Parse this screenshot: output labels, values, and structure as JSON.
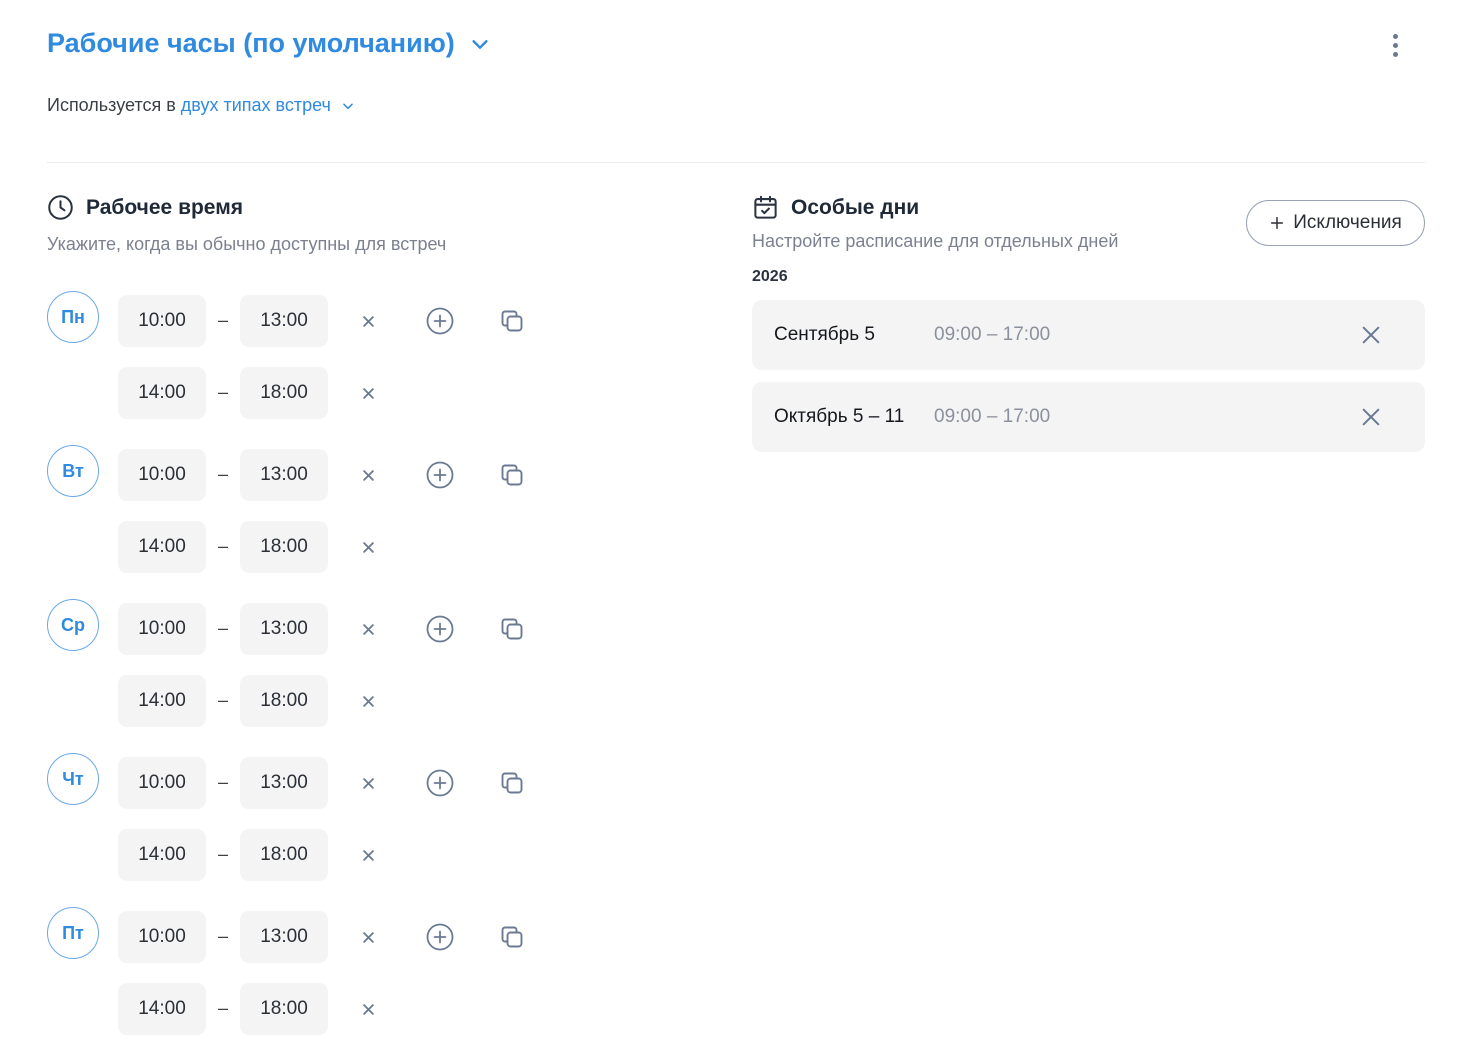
{
  "header": {
    "title": "Рабочие часы (по умолчанию)",
    "used_in_prefix": "Используется в",
    "used_in_link": "двух типах встреч"
  },
  "working_time": {
    "title": "Рабочее время",
    "subtitle": "Укажите, когда вы обычно доступны для встреч",
    "separator": "–",
    "days": [
      {
        "label": "Пн",
        "slots": [
          {
            "from": "10:00",
            "to": "13:00"
          },
          {
            "from": "14:00",
            "to": "18:00"
          }
        ]
      },
      {
        "label": "Вт",
        "slots": [
          {
            "from": "10:00",
            "to": "13:00"
          },
          {
            "from": "14:00",
            "to": "18:00"
          }
        ]
      },
      {
        "label": "Ср",
        "slots": [
          {
            "from": "10:00",
            "to": "13:00"
          },
          {
            "from": "14:00",
            "to": "18:00"
          }
        ]
      },
      {
        "label": "Чт",
        "slots": [
          {
            "from": "10:00",
            "to": "13:00"
          },
          {
            "from": "14:00",
            "to": "18:00"
          }
        ]
      },
      {
        "label": "Пт",
        "slots": [
          {
            "from": "10:00",
            "to": "13:00"
          },
          {
            "from": "14:00",
            "to": "18:00"
          }
        ]
      }
    ]
  },
  "special_days": {
    "title": "Особые дни",
    "subtitle": "Настройте расписание для отдельных дней",
    "add_button": "Исключения",
    "year": "2026",
    "items": [
      {
        "date": "Сентябрь 5",
        "time": "09:00 – 17:00"
      },
      {
        "date": "Октябрь 5 – 11",
        "time": "09:00 – 17:00"
      }
    ]
  },
  "colors": {
    "accent": "#2f8ae0",
    "field_bg": "#f4f4f5",
    "icon": "#6b7a93"
  }
}
